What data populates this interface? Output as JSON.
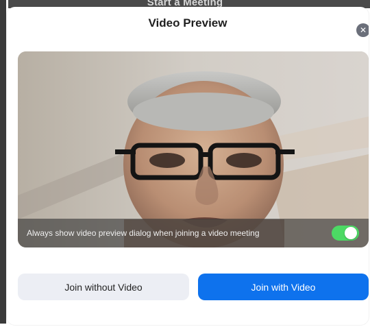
{
  "background_window": {
    "title": "Start a Meeting"
  },
  "dialog": {
    "title": "Video Preview",
    "close_icon": "close-icon",
    "preview_caption": "Always show video preview dialog when joining a video meeting",
    "toggle_state": "on",
    "toggle_color": "#4cd964",
    "buttons": {
      "join_without_video": "Join without Video",
      "join_with_video": "Join with Video"
    },
    "primary_color": "#0e72ed",
    "secondary_color": "#eceef4"
  }
}
